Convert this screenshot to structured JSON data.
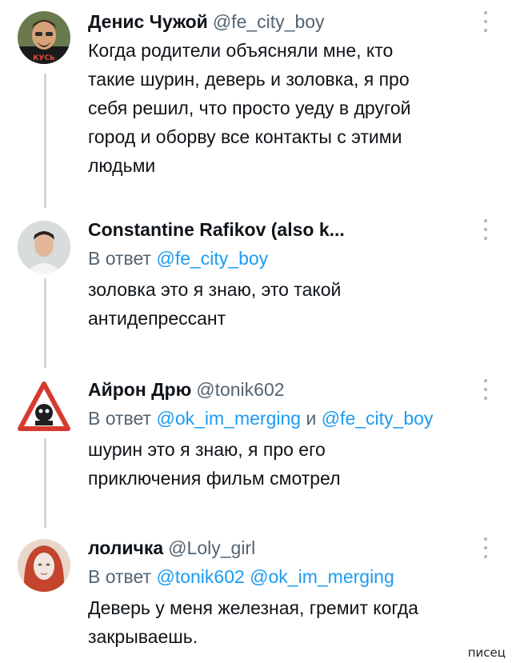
{
  "tweets": [
    {
      "name": "Денис Чужой",
      "handle": "@fe_city_boy",
      "text_lines": [
        "Когда родители объясняли мне, кто",
        "такие шурин, деверь и золовка, я про",
        "себя решил, что просто уеду в другой",
        "город и оборву все контакты с этими",
        "людьми"
      ],
      "avatar_badge": "КУСЬ"
    },
    {
      "name": "Constantine Rafikov (also k...",
      "reply_prefix": "В ответ",
      "reply_to": "@fe_city_boy",
      "text_lines": [
        "золовка это я знаю, это такой",
        "антидепрессант"
      ]
    },
    {
      "name": "Айрон Дрю",
      "handle": "@tonik602",
      "reply_prefix": "В ответ",
      "reply_to_1": "@ok_im_merging",
      "reply_conj": "и",
      "reply_to_2": "@fe_city_boy",
      "text_lines": [
        "шурин это я знаю, я про его",
        "приключения фильм смотрел"
      ]
    },
    {
      "name": "лоличка",
      "handle": "@Loly_girl",
      "reply_prefix": "В ответ",
      "reply_to_1": "@tonik602",
      "reply_to_2": "@ok_im_merging",
      "text_lines": [
        "Деверь у меня железная, гремит когда",
        "закрываешь."
      ]
    }
  ],
  "watermark": "писец",
  "colors": {
    "text": "#0f1419",
    "secondary": "#536471",
    "mention": "#1d9bf0",
    "thread_line": "#cfd9de"
  }
}
